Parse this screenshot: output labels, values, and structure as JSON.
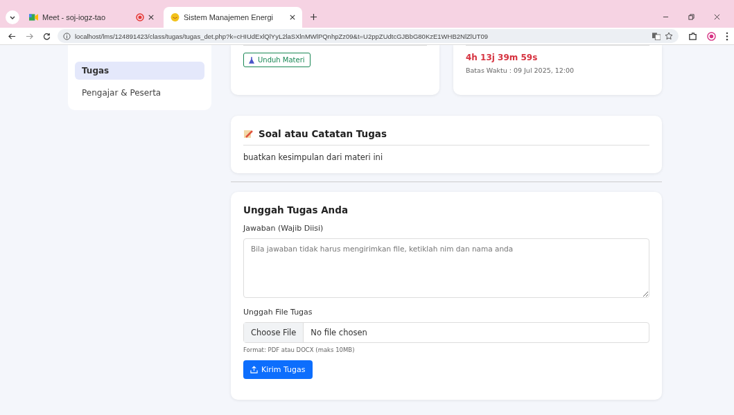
{
  "browser": {
    "tabs": [
      {
        "title": "Meet - soj-iogz-tao",
        "selected": false,
        "recording": true
      },
      {
        "title": "Sistem Manajemen Energi",
        "selected": true,
        "recording": false
      }
    ],
    "url": "localhost/lms/124891423/class/tugas/tugas_det.php?k=cHIUdExlQlYyL2laSXlnMWlPQnhpZz09&t=U2ppZUdtcGJBbG80KzE1WHB2NlZlUT09"
  },
  "sidebar": {
    "items": [
      {
        "label": "Tugas",
        "selected": true
      },
      {
        "label": "Pengajar & Peserta",
        "selected": false
      }
    ]
  },
  "material": {
    "button": "Unduh Materi"
  },
  "deadline": {
    "countdown": "4h 13j 39m 59s",
    "due": "Batas Waktu : 09 Jul 2025, 12:00"
  },
  "task": {
    "title": "Soal atau Catatan Tugas",
    "text": "buatkan kesimpulan dari materi ini"
  },
  "upload": {
    "title": "Unggah Tugas Anda",
    "answer_label": "Jawaban (Wajib Diisi)",
    "answer_placeholder": "Bila jawaban tidak harus mengirimkan file, ketiklah nim dan nama anda",
    "file_label": "Unggah File Tugas",
    "file_button": "Choose File",
    "file_status": "No file chosen",
    "hint": "Format: PDF atau DOCX (maks 10MB)",
    "submit": "Kirim Tugas"
  }
}
